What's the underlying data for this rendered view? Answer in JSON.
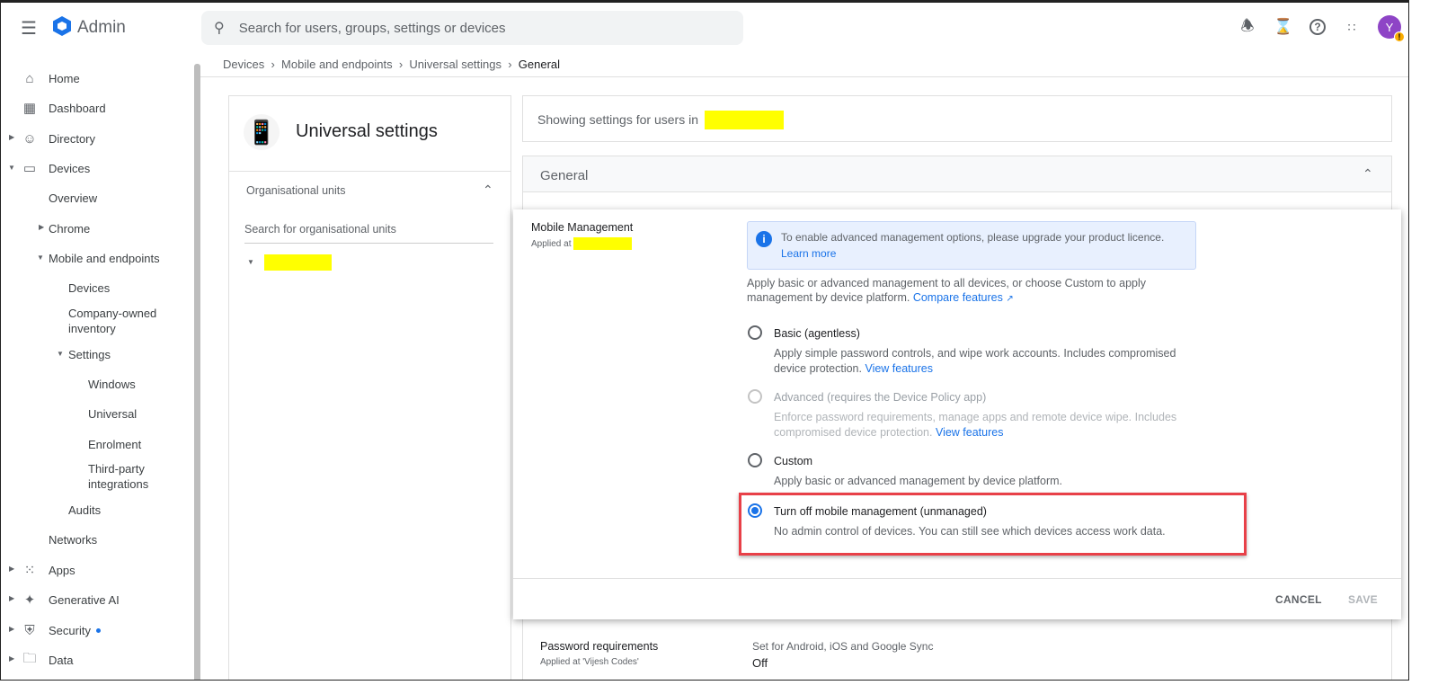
{
  "header": {
    "app_name": "Admin",
    "search_placeholder": "Search for users, groups, settings or devices",
    "avatar_initial": "Y",
    "avatar_badge": "!"
  },
  "sidebar": {
    "items": [
      {
        "label": "Home"
      },
      {
        "label": "Dashboard"
      },
      {
        "label": "Directory"
      },
      {
        "label": "Devices"
      },
      {
        "label": "Overview"
      },
      {
        "label": "Chrome"
      },
      {
        "label": "Mobile and endpoints"
      },
      {
        "label": "Devices"
      },
      {
        "label": "Company-owned inventory"
      },
      {
        "label": "Settings"
      },
      {
        "label": "Windows"
      },
      {
        "label": "Universal"
      },
      {
        "label": "Enrolment"
      },
      {
        "label": "Third-party integrations"
      },
      {
        "label": "Audits"
      },
      {
        "label": "Networks"
      },
      {
        "label": "Apps"
      },
      {
        "label": "Generative AI"
      },
      {
        "label": "Security"
      },
      {
        "label": "Data"
      }
    ]
  },
  "breadcrumb": [
    "Devices",
    "Mobile and endpoints",
    "Universal settings",
    "General"
  ],
  "left_panel": {
    "title": "Universal settings",
    "ou_label": "Organisational units",
    "ou_search_placeholder": "Search for organisational units"
  },
  "showing_settings": "Showing settings for users in",
  "general_title": "General",
  "mobile_management": {
    "title": "Mobile Management",
    "applied_at": "Applied at",
    "info_text": "To enable advanced management options, please upgrade your product licence.",
    "learn_more": "Learn more",
    "intro": "Apply basic or advanced management to all devices, or choose Custom to apply management by device platform.",
    "compare_features": "Compare features",
    "options": [
      {
        "label": "Basic (agentless)",
        "desc": "Apply simple password controls, and wipe work accounts. Includes compromised device protection.",
        "link": "View features",
        "selected": false,
        "disabled": false
      },
      {
        "label": "Advanced (requires the Device Policy app)",
        "desc": "Enforce password requirements, manage apps and remote device wipe. Includes compromised device protection.",
        "link": "View features",
        "selected": false,
        "disabled": true
      },
      {
        "label": "Custom",
        "desc": "Apply basic or advanced management by device platform.",
        "selected": false,
        "disabled": false
      },
      {
        "label": "Turn off mobile management (unmanaged)",
        "desc": "No admin control of devices. You can still see which devices access work data.",
        "selected": true,
        "disabled": false
      }
    ],
    "cancel": "CANCEL",
    "save": "SAVE"
  },
  "password_requirements": {
    "title": "Password requirements",
    "applied_at": "Applied at 'Vijesh Codes'",
    "summary": "Set for Android, iOS and Google Sync",
    "value": "Off"
  }
}
